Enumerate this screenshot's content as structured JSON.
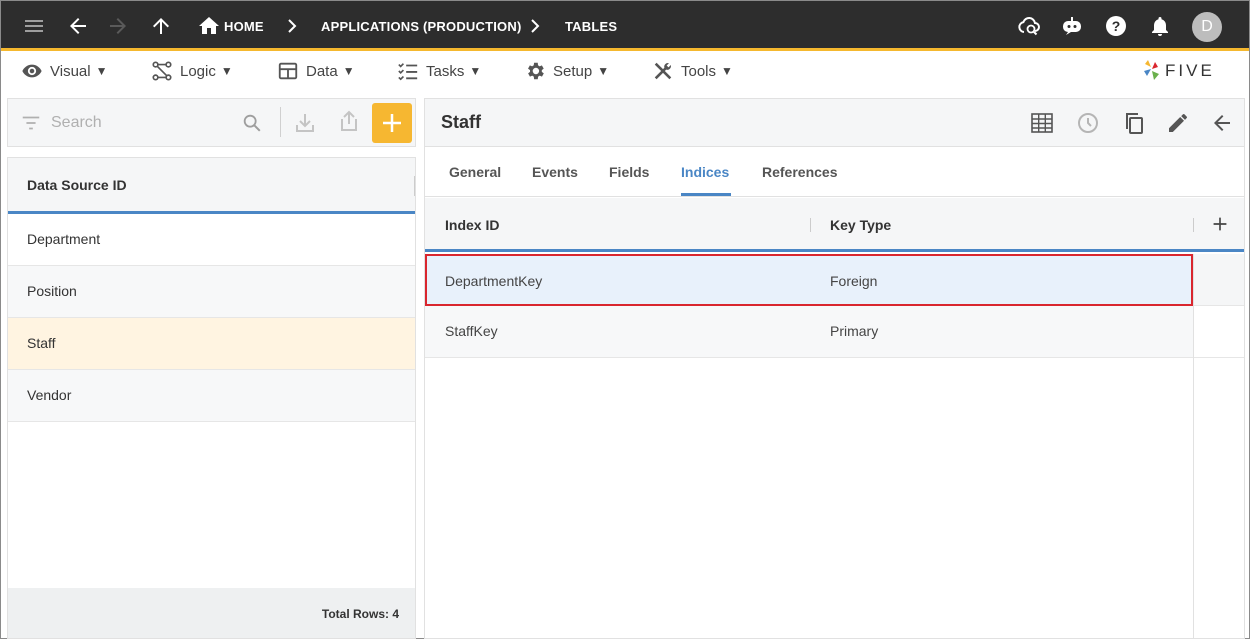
{
  "topbar": {
    "breadcrumbs": [
      "HOME",
      "APPLICATIONS (PRODUCTION)",
      "TABLES"
    ],
    "avatar_letter": "D",
    "icons": [
      "menu-icon",
      "back-arrow-icon",
      "forward-arrow-icon",
      "up-arrow-icon",
      "home-icon",
      "cloud-sync-icon",
      "chat-bot-icon",
      "help-icon",
      "bell-icon"
    ]
  },
  "menubar": {
    "items": [
      {
        "label": "Visual",
        "icon": "eye-icon"
      },
      {
        "label": "Logic",
        "icon": "logic-icon"
      },
      {
        "label": "Data",
        "icon": "table-icon"
      },
      {
        "label": "Tasks",
        "icon": "checklist-icon"
      },
      {
        "label": "Setup",
        "icon": "gear-icon"
      },
      {
        "label": "Tools",
        "icon": "tools-icon"
      }
    ],
    "caret": "▼",
    "logo_text": "FIVE"
  },
  "left": {
    "search_placeholder": "Search",
    "header": "Data Source ID",
    "rows": [
      "Department",
      "Position",
      "Staff",
      "Vendor"
    ],
    "selected_row": "Staff",
    "footer": "Total Rows: 4"
  },
  "right": {
    "title": "Staff",
    "tabs": [
      "General",
      "Events",
      "Fields",
      "Indices",
      "References"
    ],
    "active_tab": "Indices",
    "columns": [
      "Index ID",
      "Key Type"
    ],
    "rows": [
      {
        "index_id": "DepartmentKey",
        "key_type": "Foreign"
      },
      {
        "index_id": "StaffKey",
        "key_type": "Primary"
      }
    ]
  },
  "colors": {
    "accent": "#f6b731",
    "topbar": "#2d2d2d",
    "active_blue": "#4a86c5",
    "selection_border": "#d9262e"
  }
}
